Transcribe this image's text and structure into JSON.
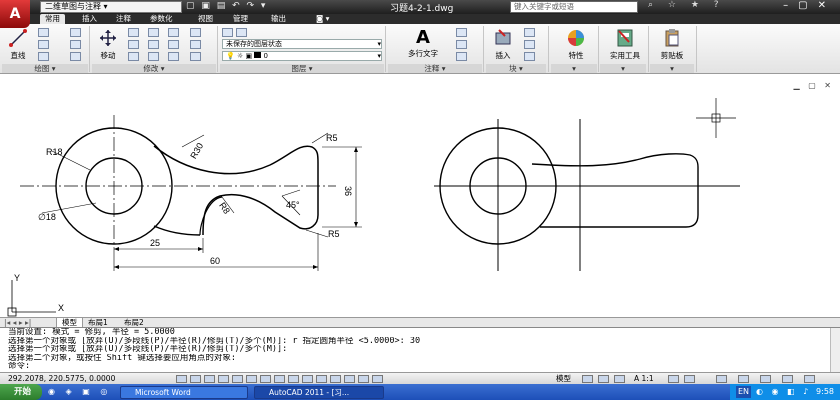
{
  "titlebar": {
    "workspace": "二维草图与注释",
    "doc_title": "习题4-2-1.dwg",
    "search_placeholder": "键入关键字或短语",
    "app_letter": "A"
  },
  "tabs": [
    "常用",
    "插入",
    "注释",
    "参数化",
    "视图",
    "管理",
    "输出"
  ],
  "ribbon": {
    "draw": {
      "label": "绘图",
      "line": "直线"
    },
    "modify": {
      "label": "修改",
      "move": "移动"
    },
    "layers": {
      "label": "图层",
      "layer_state": "未保存的图层状态",
      "layer_name": "0"
    },
    "annotation": {
      "label": "注释",
      "mtext": "多行文字"
    },
    "block": {
      "label": "块",
      "insert": "插入"
    },
    "properties": {
      "label": "特性"
    },
    "utilities": {
      "label": "实用工具"
    },
    "clipboard": {
      "label": "剪贴板"
    }
  },
  "drawing": {
    "dims": {
      "r18": "R18",
      "d18": "∅18",
      "r30": "R30",
      "r8": "R8",
      "r5_top": "R5",
      "r5_bottom": "R5",
      "d25": "25",
      "d60": "60",
      "d36": "36",
      "angle": "45°"
    },
    "ucs": {
      "x": "X",
      "y": "Y"
    }
  },
  "layout_tabs": [
    "模型",
    "布局1",
    "布局2"
  ],
  "command_lines": [
    "当前设置: 模式 = 修剪, 半径 = 5.0000",
    "选择第一个对象或 [放弃(U)/多段线(P)/半径(R)/修剪(T)/多个(M)]: r 指定圆角半径 <5.0000>: 30",
    "选择第一个对象或 [放弃(U)/多段线(P)/半径(R)/修剪(T)/多个(M)]:",
    "选择第二个对象，或按住 Shift 键选择要应用角点的对象:",
    "命令:"
  ],
  "statusbar": {
    "coords": "292.2078, 220.5775, 0.0000",
    "model": "模型",
    "scale": "A 1:1"
  },
  "taskbar": {
    "start": "开始",
    "tasks": [
      "Microsoft Word",
      "AutoCAD 2011 - [习..."
    ],
    "lang": "EN",
    "time": "9:58"
  }
}
